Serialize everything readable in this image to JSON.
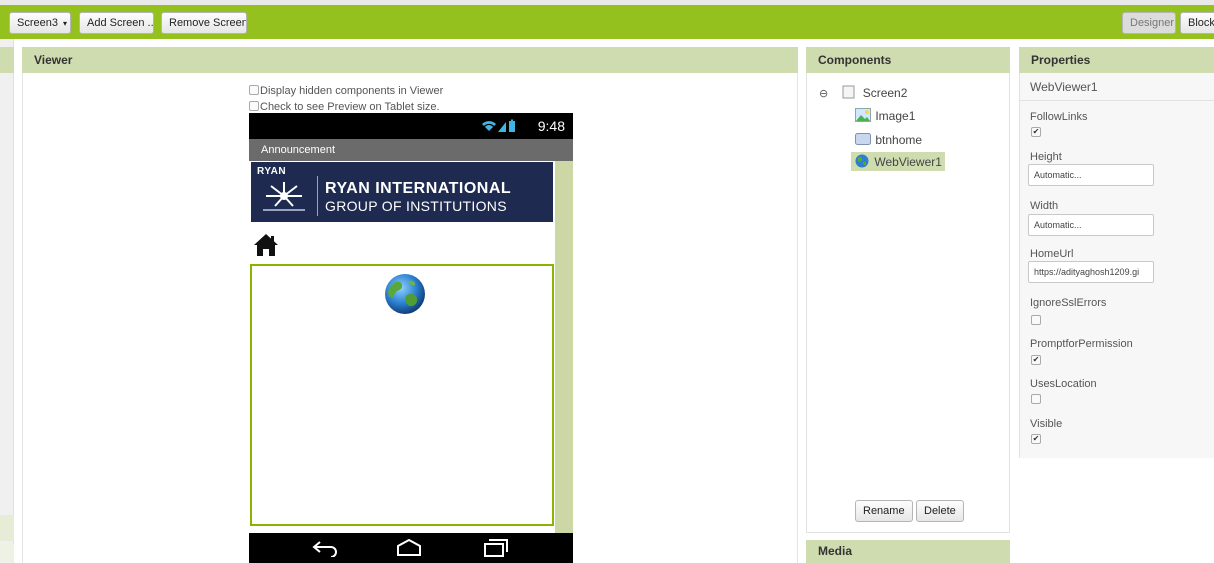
{
  "toolbar": {
    "screen_selector": "Screen3",
    "screen_selector_caret": "▾",
    "add_screen": "Add Screen ...",
    "remove_screen": "Remove Screen",
    "designer": "Designer",
    "blocks": "Block"
  },
  "viewer": {
    "title": "Viewer",
    "display_hidden": "Display hidden components in Viewer",
    "tablet_preview": "Check to see Preview on Tablet size."
  },
  "phone": {
    "time": "9:48",
    "app_title": "Announcement",
    "banner": {
      "small": "RYAN",
      "title": "RYAN INTERNATIONAL",
      "subtitle": "GROUP OF INSTITUTIONS"
    }
  },
  "components": {
    "title": "Components",
    "tree": {
      "root": "Screen2",
      "children": [
        "Image1",
        "btnhome",
        "WebViewer1"
      ]
    },
    "rename": "Rename",
    "delete": "Delete",
    "media_title": "Media"
  },
  "properties": {
    "title": "Properties",
    "component": "WebViewer1",
    "items": [
      {
        "label": "FollowLinks",
        "type": "checkbox",
        "checked": true
      },
      {
        "label": "Height",
        "type": "input",
        "value": "Automatic..."
      },
      {
        "label": "Width",
        "type": "input",
        "value": "Automatic..."
      },
      {
        "label": "HomeUrl",
        "type": "input",
        "value": "https://adityaghosh1209.gi"
      },
      {
        "label": "IgnoreSslErrors",
        "type": "checkbox",
        "checked": false
      },
      {
        "label": "PromptforPermission",
        "type": "checkbox",
        "checked": true
      },
      {
        "label": "UsesLocation",
        "type": "checkbox",
        "checked": false
      },
      {
        "label": "Visible",
        "type": "checkbox",
        "checked": true
      }
    ]
  },
  "colors": {
    "toolbar": "#95c11f",
    "panel_header": "#cfdcb0",
    "selection": "#cfdcb0",
    "webviewer_border": "#8ab400"
  }
}
